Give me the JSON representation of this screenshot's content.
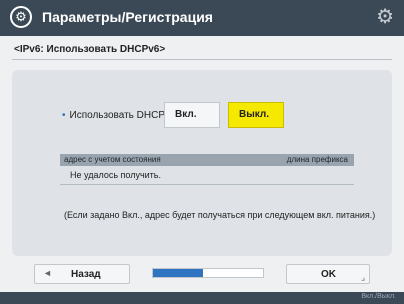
{
  "header": {
    "title": "Параметры/Регистрация",
    "app_icon": "settings-registration-icon",
    "right_icon": "gear-icon"
  },
  "subtitle": "<IPv6: Использовать DHCPv6>",
  "option": {
    "label": "Использовать DHCPv6",
    "on_label": "Вкл.",
    "off_label": "Выкл.",
    "selected": "off"
  },
  "table": {
    "header_left": "адрес с учетом состояния",
    "header_right": "длина префикса",
    "row_value": "Не удалось получить."
  },
  "note": "(Если задано Вкл., адрес будет получаться при следующем вкл. питания.)",
  "footer": {
    "back_label": "Назад",
    "ok_label": "OK",
    "progress": 0.45,
    "status_text": "Вкл./Выкл."
  },
  "colors": {
    "titlebar": "#3b4957",
    "selected_button": "#f5e900",
    "progress_fill": "#2f74c0"
  }
}
